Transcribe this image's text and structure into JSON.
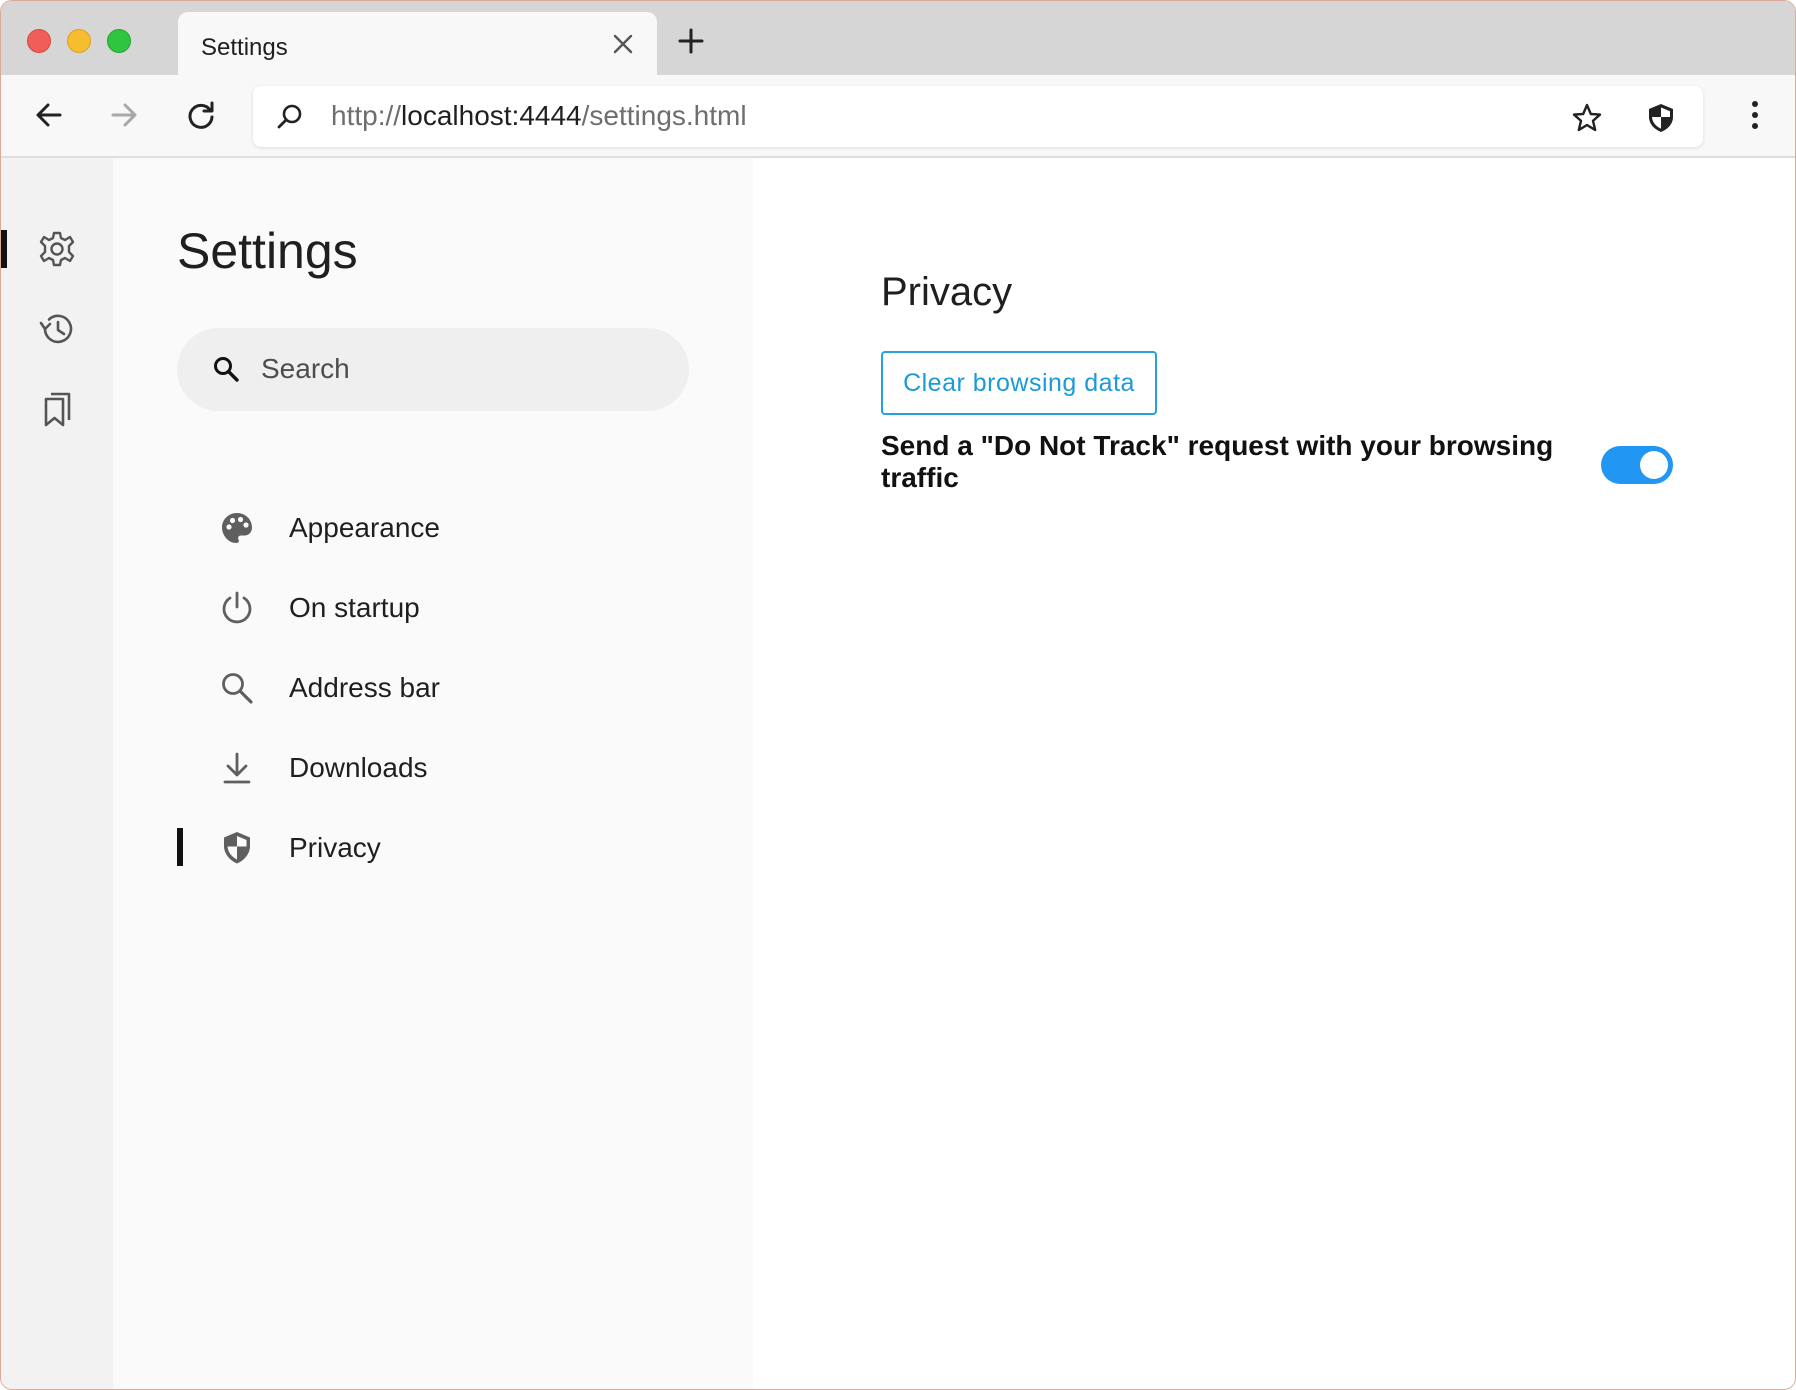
{
  "browser": {
    "tab_title": "Settings",
    "url": {
      "scheme": "http://",
      "host": "localhost:4444",
      "path": "/settings.html"
    }
  },
  "sidebar_rail": {
    "items": [
      {
        "name": "settings",
        "icon": "gear-icon",
        "active": true
      },
      {
        "name": "history",
        "icon": "history-icon",
        "active": false
      },
      {
        "name": "bookmarks",
        "icon": "bookmarks-icon",
        "active": false
      }
    ]
  },
  "settings_nav": {
    "title": "Settings",
    "search_placeholder": "Search",
    "items": [
      {
        "label": "Appearance",
        "icon": "palette-icon",
        "active": false
      },
      {
        "label": "On startup",
        "icon": "power-icon",
        "active": false
      },
      {
        "label": "Address bar",
        "icon": "search-icon",
        "active": false
      },
      {
        "label": "Downloads",
        "icon": "download-icon",
        "active": false
      },
      {
        "label": "Privacy",
        "icon": "shield-icon",
        "active": true
      }
    ]
  },
  "privacy": {
    "title": "Privacy",
    "clear_button": "Clear browsing data",
    "dnt_label": "Send a \"Do Not Track\" request with your browsing traffic",
    "dnt_enabled": true
  },
  "colors": {
    "accent": "#2196f3",
    "button_text": "#1c9ad6"
  }
}
